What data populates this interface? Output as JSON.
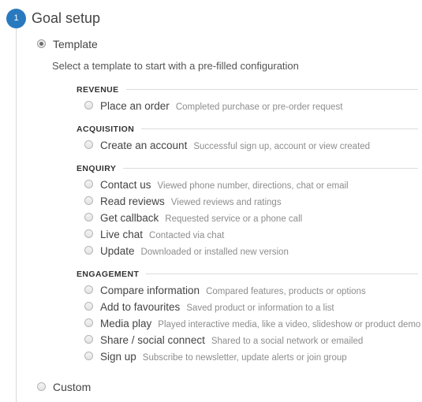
{
  "step": {
    "number": "1",
    "title": "Goal setup",
    "accent_color": "#2979bf"
  },
  "options": {
    "template": {
      "label": "Template",
      "selected": true,
      "description": "Select a template to start with a pre-filled configuration"
    },
    "custom": {
      "label": "Custom",
      "selected": false
    }
  },
  "groups": [
    {
      "title": "REVENUE",
      "items": [
        {
          "name": "Place an order",
          "desc": "Completed purchase or pre-order request"
        }
      ]
    },
    {
      "title": "ACQUISITION",
      "items": [
        {
          "name": "Create an account",
          "desc": "Successful sign up, account or view created"
        }
      ]
    },
    {
      "title": "ENQUIRY",
      "items": [
        {
          "name": "Contact us",
          "desc": "Viewed phone number, directions, chat or email"
        },
        {
          "name": "Read reviews",
          "desc": "Viewed reviews and ratings"
        },
        {
          "name": "Get callback",
          "desc": "Requested service or a phone call"
        },
        {
          "name": "Live chat",
          "desc": "Contacted via chat"
        },
        {
          "name": "Update",
          "desc": "Downloaded or installed new version"
        }
      ]
    },
    {
      "title": "ENGAGEMENT",
      "items": [
        {
          "name": "Compare information",
          "desc": "Compared features, products or options"
        },
        {
          "name": "Add to favourites",
          "desc": "Saved product or information to a list"
        },
        {
          "name": "Media play",
          "desc": "Played interactive media, like a video, slideshow or product demo"
        },
        {
          "name": "Share / social connect",
          "desc": "Shared to a social network or emailed"
        },
        {
          "name": "Sign up",
          "desc": "Subscribe to newsletter, update alerts or join group"
        }
      ]
    }
  ]
}
